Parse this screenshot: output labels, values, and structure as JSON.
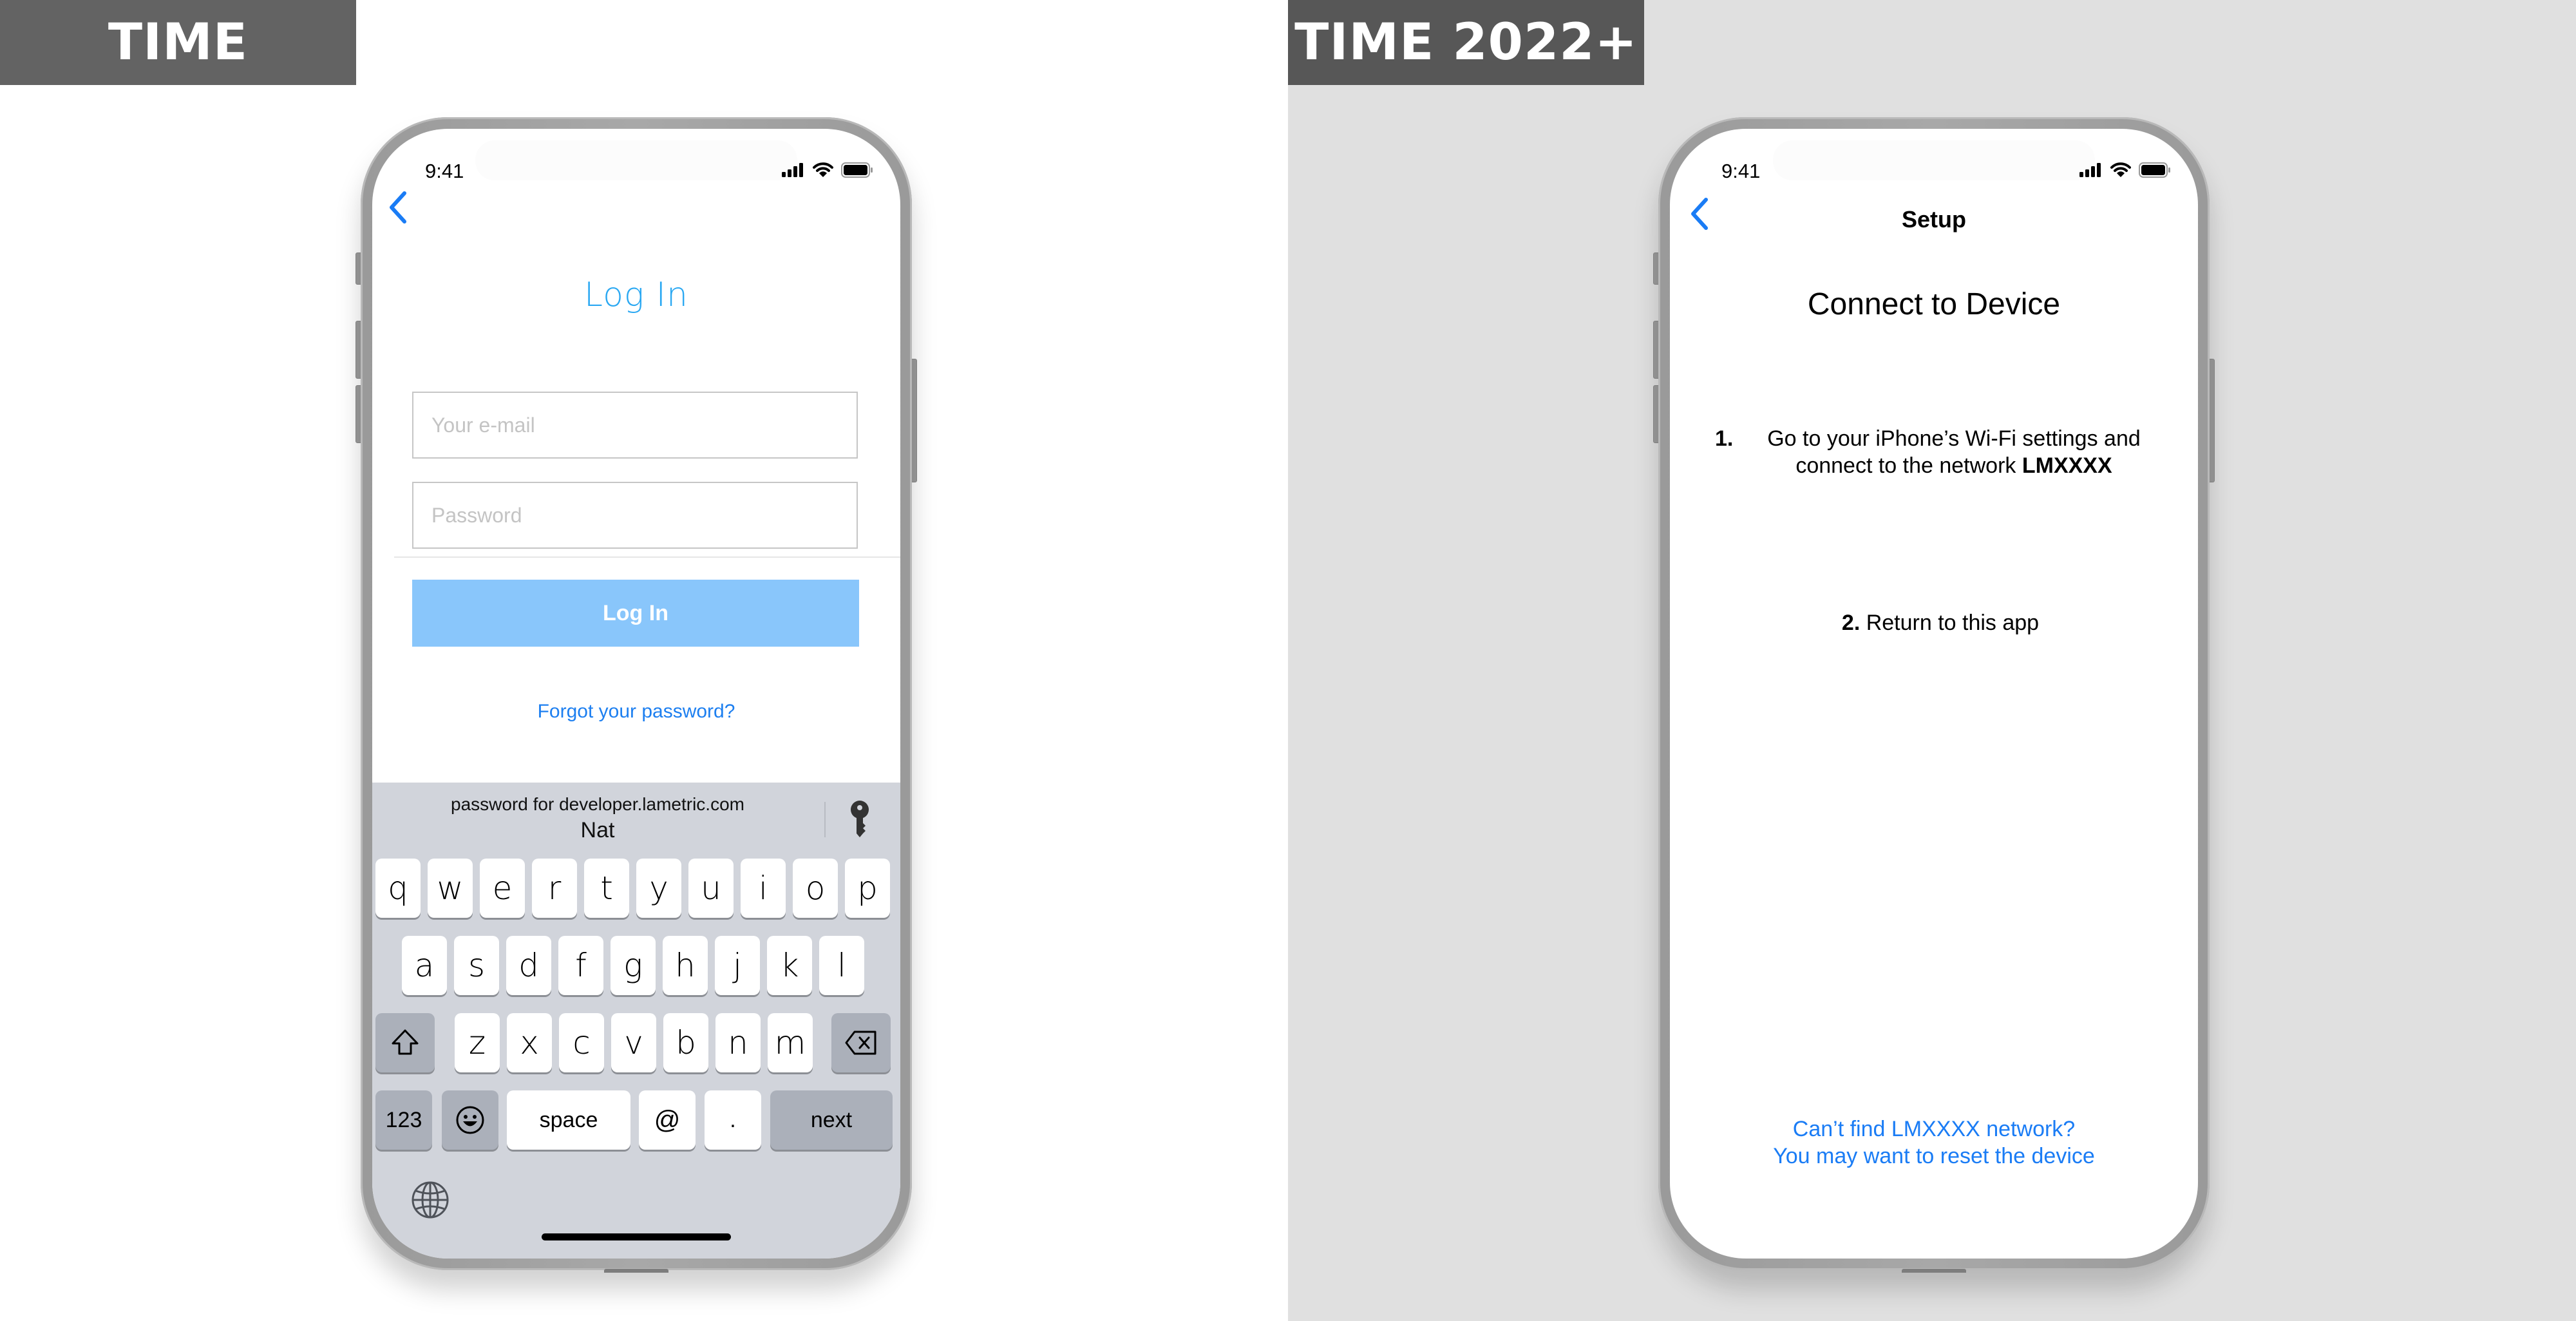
{
  "left_panel": {
    "label": "TIME",
    "phone": {
      "status_bar": {
        "time": "9:41",
        "icons": [
          "signal-icon",
          "wifi-icon",
          "battery-icon"
        ]
      },
      "back_icon": "chevron-left-icon",
      "title": "Log In",
      "email_field": {
        "placeholder": "Your e-mail",
        "value": ""
      },
      "password_field": {
        "placeholder": "Password",
        "value": ""
      },
      "login_button": "Log In",
      "forgot_link": "Forgot your password?",
      "keyboard": {
        "suggestion_line1": "password for developer.lametric.com",
        "suggestion_line2": "Nat",
        "suggestion_icon": "key-icon",
        "row1": [
          "q",
          "w",
          "e",
          "r",
          "t",
          "y",
          "u",
          "i",
          "o",
          "p"
        ],
        "row2": [
          "a",
          "s",
          "d",
          "f",
          "g",
          "h",
          "j",
          "k",
          "l"
        ],
        "row3": [
          "z",
          "x",
          "c",
          "v",
          "b",
          "n",
          "m"
        ],
        "shift_icon": "shift-icon",
        "delete_icon": "backspace-icon",
        "numbers_label": "123",
        "emoji_icon": "emoji-icon",
        "space_label": "space",
        "at_label": "@",
        "dot_label": ".",
        "next_label": "next",
        "globe_icon": "globe-icon"
      }
    }
  },
  "right_panel": {
    "label": "TIME 2022+",
    "phone": {
      "status_bar": {
        "time": "9:41",
        "icons": [
          "signal-icon",
          "wifi-icon",
          "battery-icon"
        ]
      },
      "back_icon": "chevron-left-icon",
      "nav_title": "Setup",
      "title": "Connect to Device",
      "step1": {
        "number": "1.",
        "text": "Go to your iPhone’s Wi-Fi settings and connect to the network ",
        "network": "LMXXXX"
      },
      "step2": {
        "number": "2.",
        "text": " Return to this app"
      },
      "reset_link_line1": "Can’t find LMXXXX network?",
      "reset_link_line2": "You may want to reset the device"
    }
  },
  "colors": {
    "left_label_bg": "#636363",
    "right_label_bg": "#575757",
    "right_panel_bg": "#e0e0e0",
    "login_title": "#2aa8f2",
    "login_button_bg": "#89c6fb",
    "link_blue": "#1a7cf5",
    "keyboard_bg": "#d1d4db"
  }
}
